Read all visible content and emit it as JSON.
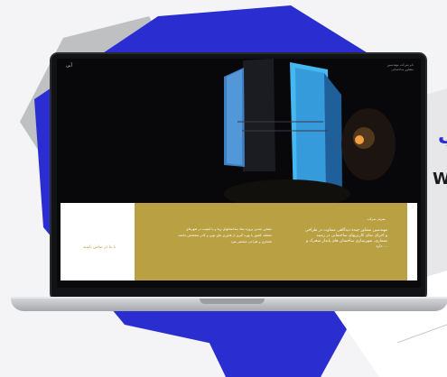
{
  "brand": {
    "top_fragment": "ب",
    "bottom_fragment": "W"
  },
  "site": {
    "logo_text": "آبی",
    "header_lines": [
      "نام شرکت مهندسین",
      "مشاور ساختمانی"
    ],
    "footer": {
      "link_label": "با ما در تماس باشید",
      "left_paragraph": "مشاور چندین پروژه نماد ساختمانهای زیبا و با کیفیت در شهرهای مختلف کشور با بهره گیری از فناوری های نوین و کادر متخصص جامعه معماری و طراحی منحصر بفرد",
      "right_title": "معرفی شرکت",
      "right_paragraph": "مهندسین مشاور چیده دیدگاهی متفاوت در طراحی و اجرای نمای کاربریهای ساختمانی در زمینه معماری، شهرسازی ساختمان های پایدار متحرک و ... دارد"
    }
  },
  "colors": {
    "accent_blue": "#2a2ed0",
    "gold": "#b8a043",
    "facade_blue": "#46b8f0"
  }
}
